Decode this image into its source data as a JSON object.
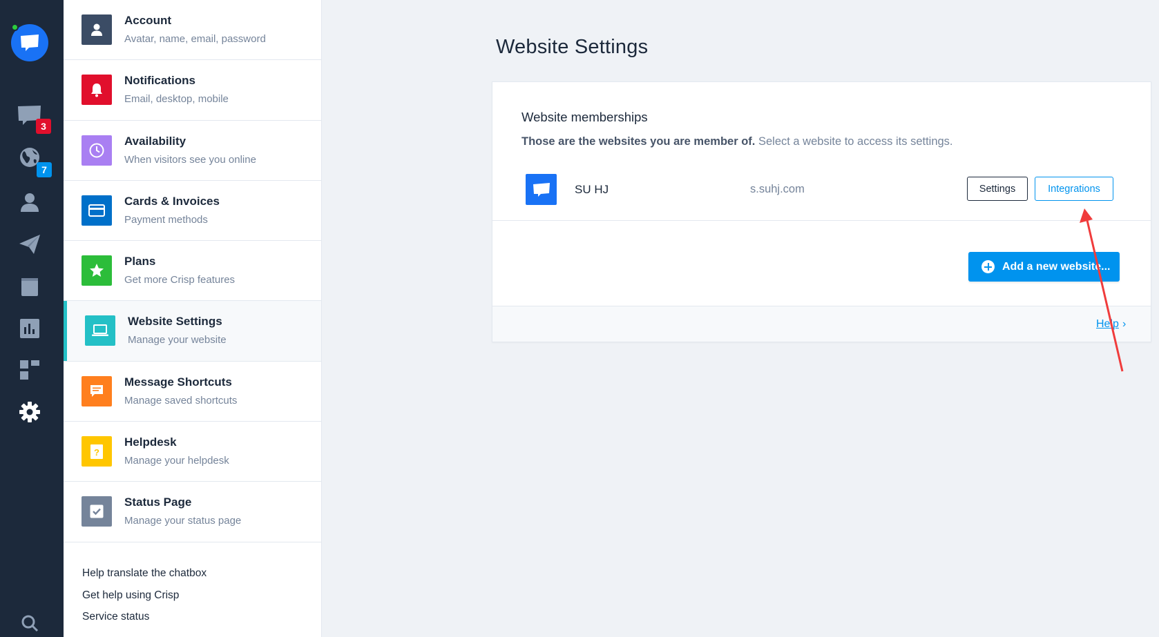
{
  "rail": {
    "badges": {
      "chats": "3",
      "visitors": "7"
    }
  },
  "menu": {
    "items": [
      {
        "title": "Account",
        "subtitle": "Avatar, name, email, password",
        "color": "#3b4c65",
        "icon": "person-icon"
      },
      {
        "title": "Notifications",
        "subtitle": "Email, desktop, mobile",
        "color": "#e10f2c",
        "icon": "bell-icon"
      },
      {
        "title": "Availability",
        "subtitle": "When visitors see you online",
        "color": "#a97ff2",
        "icon": "clock-icon"
      },
      {
        "title": "Cards & Invoices",
        "subtitle": "Payment methods",
        "color": "#0070c9",
        "icon": "credit-card-icon"
      },
      {
        "title": "Plans",
        "subtitle": "Get more Crisp features",
        "color": "#2cbd3a",
        "icon": "star-icon"
      },
      {
        "title": "Website Settings",
        "subtitle": "Manage your website",
        "color": "#24c0c6",
        "icon": "laptop-icon"
      },
      {
        "title": "Message Shortcuts",
        "subtitle": "Manage saved shortcuts",
        "color": "#ff7f1e",
        "icon": "message-icon"
      },
      {
        "title": "Helpdesk",
        "subtitle": "Manage your helpdesk",
        "color": "#ffc600",
        "icon": "helpdesk-book-icon"
      },
      {
        "title": "Status Page",
        "subtitle": "Manage your status page",
        "color": "#75849a",
        "icon": "checkbox-icon"
      }
    ],
    "links": [
      "Help translate the chatbox",
      "Get help using Crisp",
      "Service status"
    ]
  },
  "main": {
    "title": "Website Settings",
    "card": {
      "title": "Website memberships",
      "desc_bold": "Those are the websites you are member of.",
      "desc_rest": "Select a website to access its settings.",
      "website": {
        "name": "SU HJ",
        "domain": "s.suhj.com"
      },
      "settings_label": "Settings",
      "integrations_label": "Integrations",
      "add_label": "Add a new website...",
      "help_label": "Help",
      "help_chevron": "›"
    }
  },
  "colors": {
    "accent": "#0093ee",
    "rail": "#1c293b",
    "annotation": "#f03c3c"
  }
}
